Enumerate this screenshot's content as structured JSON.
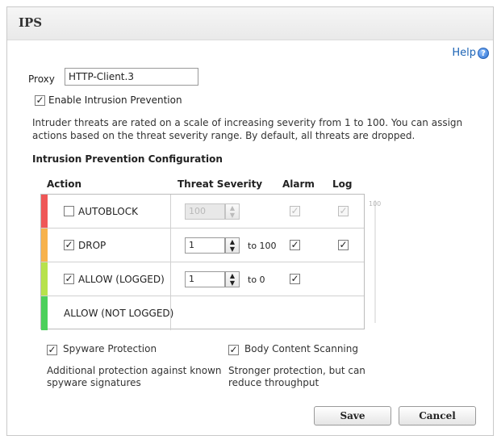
{
  "dialog": {
    "title": "IPS",
    "help_label": "Help",
    "help_icon": "help-circle-icon"
  },
  "proxy": {
    "label": "Proxy",
    "value": "HTTP-Client.3"
  },
  "enable_ips": {
    "label": "Enable Intrusion Prevention",
    "checked": true
  },
  "description": "Intruder threats are rated on a scale of increasing severity from 1 to 100.  You can assign actions based on the threat severity range. By default, all threats are dropped.",
  "config": {
    "heading": "Intrusion Prevention Configuration",
    "columns": {
      "action": "Action",
      "threat_severity": "Threat Severity",
      "alarm": "Alarm",
      "log": "Log"
    },
    "rows": [
      {
        "label": "AUTOBLOCK",
        "checked": false,
        "severity": "100",
        "to_text": "",
        "alarm": true,
        "log": true,
        "disabled": true,
        "color": "#ef5757"
      },
      {
        "label": "DROP",
        "checked": true,
        "severity": "1",
        "to_text": "to 100",
        "alarm": true,
        "log": true,
        "disabled": false,
        "color": "#f7b24c"
      },
      {
        "label": "ALLOW (LOGGED)",
        "checked": true,
        "severity": "1",
        "to_text": "to 0",
        "alarm": true,
        "log": false,
        "disabled": false,
        "color": "#b7e24c"
      },
      {
        "label": "ALLOW (NOT LOGGED)",
        "checked": null,
        "color": "#4cd05b"
      }
    ],
    "slider_label": "100"
  },
  "spyware": {
    "label": "Spyware Protection",
    "checked": true,
    "desc": "Additional protection against known spyware signatures"
  },
  "body_scan": {
    "label": "Body Content Scanning",
    "checked": true,
    "desc": "Stronger protection, but can reduce throughput"
  },
  "buttons": {
    "save": "Save",
    "cancel": "Cancel"
  }
}
